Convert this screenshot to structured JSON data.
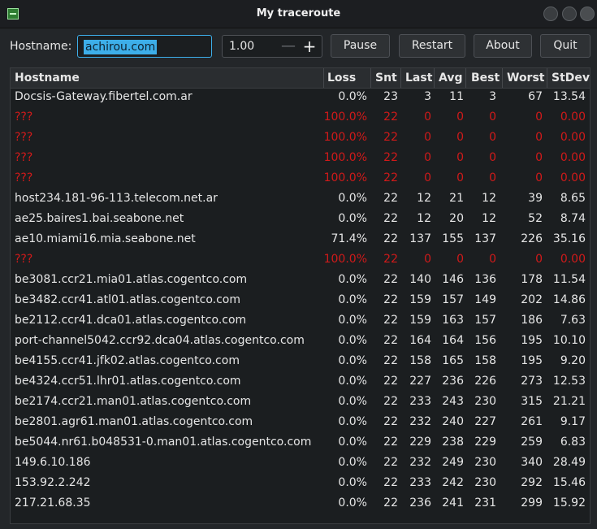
{
  "window": {
    "title": "My traceroute"
  },
  "toolbar": {
    "hostname_label": "Hostname:",
    "hostname_value": "achirou.com",
    "interval_value": "1.00",
    "minus_glyph": "—",
    "plus_glyph": "+",
    "pause_label": "Pause",
    "restart_label": "Restart",
    "about_label": "About",
    "quit_label": "Quit"
  },
  "colors": {
    "accent": "#3daee9",
    "error": "#d11a1a"
  },
  "table": {
    "columns": [
      "Hostname",
      "Loss",
      "Snt",
      "Last",
      "Avg",
      "Best",
      "Worst",
      "StDev"
    ],
    "rows": [
      {
        "host": "Docsis-Gateway.fibertel.com.ar",
        "loss": "0.0%",
        "snt": "23",
        "last": "3",
        "avg": "11",
        "best": "3",
        "worst": "67",
        "stdev": "13.54",
        "fail": false
      },
      {
        "host": "???",
        "loss": "100.0%",
        "snt": "22",
        "last": "0",
        "avg": "0",
        "best": "0",
        "worst": "0",
        "stdev": "0.00",
        "fail": true
      },
      {
        "host": "???",
        "loss": "100.0%",
        "snt": "22",
        "last": "0",
        "avg": "0",
        "best": "0",
        "worst": "0",
        "stdev": "0.00",
        "fail": true
      },
      {
        "host": "???",
        "loss": "100.0%",
        "snt": "22",
        "last": "0",
        "avg": "0",
        "best": "0",
        "worst": "0",
        "stdev": "0.00",
        "fail": true
      },
      {
        "host": "???",
        "loss": "100.0%",
        "snt": "22",
        "last": "0",
        "avg": "0",
        "best": "0",
        "worst": "0",
        "stdev": "0.00",
        "fail": true
      },
      {
        "host": "host234.181-96-113.telecom.net.ar",
        "loss": "0.0%",
        "snt": "22",
        "last": "12",
        "avg": "21",
        "best": "12",
        "worst": "39",
        "stdev": "8.65",
        "fail": false
      },
      {
        "host": "ae25.baires1.bai.seabone.net",
        "loss": "0.0%",
        "snt": "22",
        "last": "12",
        "avg": "20",
        "best": "12",
        "worst": "52",
        "stdev": "8.74",
        "fail": false
      },
      {
        "host": "ae10.miami16.mia.seabone.net",
        "loss": "71.4%",
        "snt": "22",
        "last": "137",
        "avg": "155",
        "best": "137",
        "worst": "226",
        "stdev": "35.16",
        "fail": false
      },
      {
        "host": "???",
        "loss": "100.0%",
        "snt": "22",
        "last": "0",
        "avg": "0",
        "best": "0",
        "worst": "0",
        "stdev": "0.00",
        "fail": true
      },
      {
        "host": "be3081.ccr21.mia01.atlas.cogentco.com",
        "loss": "0.0%",
        "snt": "22",
        "last": "140",
        "avg": "146",
        "best": "136",
        "worst": "178",
        "stdev": "11.54",
        "fail": false
      },
      {
        "host": "be3482.ccr41.atl01.atlas.cogentco.com",
        "loss": "0.0%",
        "snt": "22",
        "last": "159",
        "avg": "157",
        "best": "149",
        "worst": "202",
        "stdev": "14.86",
        "fail": false
      },
      {
        "host": "be2112.ccr41.dca01.atlas.cogentco.com",
        "loss": "0.0%",
        "snt": "22",
        "last": "159",
        "avg": "163",
        "best": "157",
        "worst": "186",
        "stdev": "7.63",
        "fail": false
      },
      {
        "host": "port-channel5042.ccr92.dca04.atlas.cogentco.com",
        "loss": "0.0%",
        "snt": "22",
        "last": "164",
        "avg": "164",
        "best": "156",
        "worst": "195",
        "stdev": "10.10",
        "fail": false
      },
      {
        "host": "be4155.ccr41.jfk02.atlas.cogentco.com",
        "loss": "0.0%",
        "snt": "22",
        "last": "158",
        "avg": "165",
        "best": "158",
        "worst": "195",
        "stdev": "9.20",
        "fail": false
      },
      {
        "host": "be4324.ccr51.lhr01.atlas.cogentco.com",
        "loss": "0.0%",
        "snt": "22",
        "last": "227",
        "avg": "236",
        "best": "226",
        "worst": "273",
        "stdev": "12.53",
        "fail": false
      },
      {
        "host": "be2174.ccr21.man01.atlas.cogentco.com",
        "loss": "0.0%",
        "snt": "22",
        "last": "233",
        "avg": "243",
        "best": "230",
        "worst": "315",
        "stdev": "21.21",
        "fail": false
      },
      {
        "host": "be2801.agr61.man01.atlas.cogentco.com",
        "loss": "0.0%",
        "snt": "22",
        "last": "232",
        "avg": "240",
        "best": "227",
        "worst": "261",
        "stdev": "9.17",
        "fail": false
      },
      {
        "host": "be5044.nr61.b048531-0.man01.atlas.cogentco.com",
        "loss": "0.0%",
        "snt": "22",
        "last": "229",
        "avg": "238",
        "best": "229",
        "worst": "259",
        "stdev": "6.83",
        "fail": false
      },
      {
        "host": "149.6.10.186",
        "loss": "0.0%",
        "snt": "22",
        "last": "232",
        "avg": "249",
        "best": "230",
        "worst": "340",
        "stdev": "28.49",
        "fail": false
      },
      {
        "host": "153.92.2.242",
        "loss": "0.0%",
        "snt": "22",
        "last": "233",
        "avg": "242",
        "best": "230",
        "worst": "292",
        "stdev": "15.46",
        "fail": false
      },
      {
        "host": "217.21.68.35",
        "loss": "0.0%",
        "snt": "22",
        "last": "236",
        "avg": "241",
        "best": "231",
        "worst": "299",
        "stdev": "15.92",
        "fail": false
      }
    ]
  }
}
